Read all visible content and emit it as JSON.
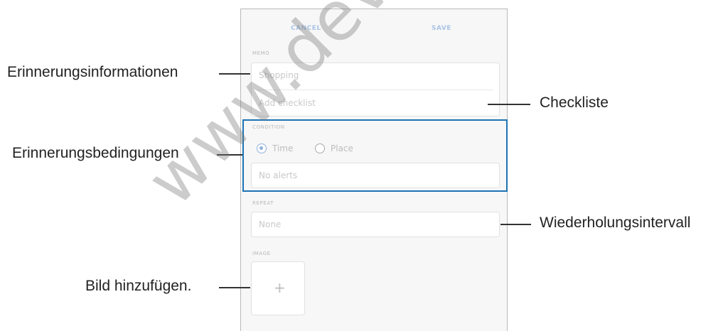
{
  "form": {
    "cancel_label": "CANCEL",
    "save_label": "SAVE",
    "memo_section": "MEMO",
    "title_value": "Shopping",
    "checklist_placeholder": "Add checklist",
    "conditions_section": "CONDITION",
    "option_time": "Time",
    "option_place": "Place",
    "alert_value": "No alerts",
    "repeat_section": "REPEAT",
    "repeat_value": "None",
    "image_section": "IMAGE",
    "add_image_glyph": "+"
  },
  "callouts": {
    "reminder_info": "Erinnerungsinformationen",
    "checklist": "Checkliste",
    "reminder_conditions": "Erinnerungsbedingungen",
    "repeat_interval": "Wiederholungsintervall",
    "add_image": "Bild hinzufügen."
  },
  "watermark": "www.devicel"
}
